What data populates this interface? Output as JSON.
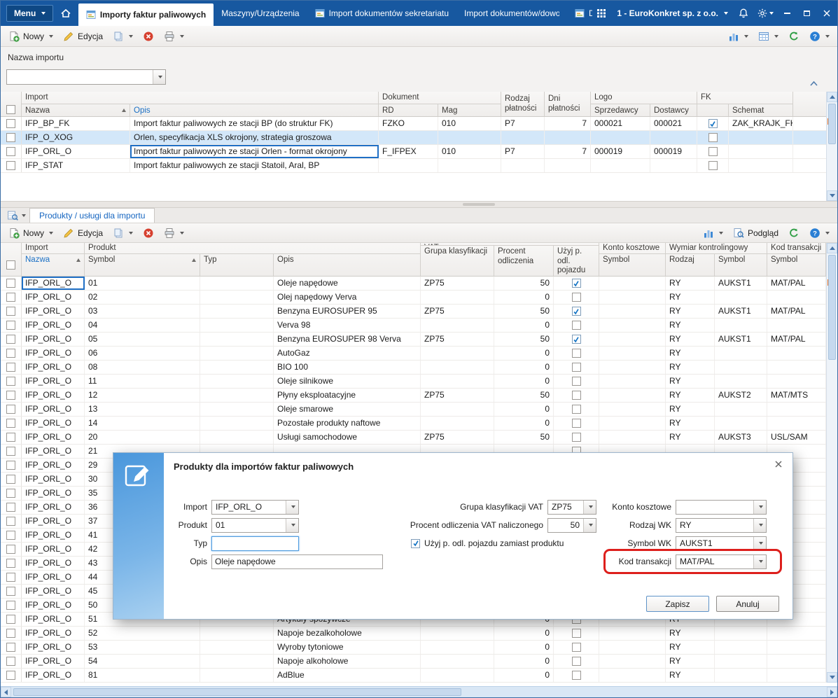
{
  "titlebar": {
    "menu_label": "Menu",
    "company_label": "1 - EuroKonkret sp. z o.o.",
    "tabs": [
      {
        "label": "Importy faktur paliwowych",
        "active": true,
        "icon": true
      },
      {
        "label": "Maszyny/Urządzenia",
        "active": false,
        "icon": false
      },
      {
        "label": "Import dokumentów sekretariatu",
        "active": false,
        "icon": true
      },
      {
        "label": "Import dokumentów/dowodów",
        "active": false,
        "icon": false,
        "truncate": true
      },
      {
        "label": "Dokumenty",
        "active": false,
        "icon": true
      }
    ]
  },
  "toolbars": {
    "new": "Nowy",
    "edit": "Edycja",
    "preview": "Podgląd"
  },
  "filter_panel": {
    "label": "Nazwa importu",
    "value": ""
  },
  "upper_grid": {
    "groups": {
      "import": "Import",
      "dokument": "Dokument",
      "logo": "Logo",
      "fk": "FK"
    },
    "columns": {
      "nazwa": "Nazwa",
      "opis": "Opis",
      "rd": "RD",
      "mag": "Mag",
      "rodzaj": "Rodzaj płatności",
      "dni": "Dni płatności",
      "sprzedawcy": "Sprzedawcy",
      "dostawcy": "Dostawcy",
      "schemat": "Schemat"
    },
    "sort_column": "nazwa",
    "focus_column": "opis",
    "rows": [
      {
        "nazwa": "IFP_BP_FK",
        "opis": "Import faktur paliwowych ze stacji BP (do struktur FK)",
        "rd": "FZKO",
        "mag": "010",
        "rodzaj": "P7",
        "dni": "7",
        "sprzedawcy": "000021",
        "dostawcy": "000021",
        "fk": true,
        "schemat": "ZAK_KRAJK_FK"
      },
      {
        "nazwa": "IFP_O_XOG",
        "opis": "Orlen, specyfikacja XLS okrojony, strategia groszowa",
        "rd": "",
        "mag": "",
        "rodzaj": "",
        "dni": "",
        "sprzedawcy": "",
        "dostawcy": "",
        "fk": false,
        "schemat": "",
        "selected": true
      },
      {
        "nazwa": "IFP_ORL_O",
        "opis": "Import faktur paliwowych ze stacji Orlen - format okrojony",
        "rd": "F_IFPEX",
        "mag": "010",
        "rodzaj": "P7",
        "dni": "7",
        "sprzedawcy": "000019",
        "dostawcy": "000019",
        "fk": false,
        "schemat": "",
        "focused_cell": "opis"
      },
      {
        "nazwa": "IFP_STAT",
        "opis": "Import faktur paliwowych ze stacji Statoil, Aral, BP",
        "rd": "",
        "mag": "",
        "rodzaj": "",
        "dni": "",
        "sprzedawcy": "",
        "dostawcy": "",
        "fk": false,
        "schemat": ""
      }
    ]
  },
  "lower_pane": {
    "tab_label": "Produkty / usługi dla importu"
  },
  "lower_grid": {
    "groups": {
      "import": "Import",
      "produkt": "Produkt",
      "vat": "VAT",
      "konto": "Konto kosztowe",
      "wymiar": "Wymiar kontrolingowy",
      "kod": "Kod transakcji"
    },
    "columns": {
      "nazwa": "Nazwa",
      "symbol": "Symbol",
      "typ": "Typ",
      "opis": "Opis",
      "grupa": "Grupa klasyfikacji",
      "procent": "Procent odliczenia",
      "uzyj": "Użyj p. odl. pojazdu",
      "konto_symbol": "Symbol",
      "rodzaj": "Rodzaj",
      "wymiar_symbol": "Symbol",
      "kod_symbol": "Symbol"
    },
    "sort_columns": [
      "nazwa",
      "symbol"
    ],
    "focus_column": "nazwa",
    "rows": [
      {
        "nazwa": "IFP_ORL_O",
        "symbol": "01",
        "typ": "",
        "opis": "Oleje napędowe",
        "grupa": "ZP75",
        "procent": "50",
        "uzyj": true,
        "konto": "",
        "rodzaj": "RY",
        "wymiar_symbol": "AUKST1",
        "kod": "MAT/PAL",
        "focused_cell": "nazwa"
      },
      {
        "nazwa": "IFP_ORL_O",
        "symbol": "02",
        "typ": "",
        "opis": "Olej napędowy Verva",
        "grupa": "",
        "procent": "0",
        "uzyj": false,
        "konto": "",
        "rodzaj": "RY",
        "wymiar_symbol": "",
        "kod": ""
      },
      {
        "nazwa": "IFP_ORL_O",
        "symbol": "03",
        "typ": "",
        "opis": "Benzyna EUROSUPER 95",
        "grupa": "ZP75",
        "procent": "50",
        "uzyj": true,
        "konto": "",
        "rodzaj": "RY",
        "wymiar_symbol": "AUKST1",
        "kod": "MAT/PAL"
      },
      {
        "nazwa": "IFP_ORL_O",
        "symbol": "04",
        "typ": "",
        "opis": "Verva 98",
        "grupa": "",
        "procent": "0",
        "uzyj": false,
        "konto": "",
        "rodzaj": "RY",
        "wymiar_symbol": "",
        "kod": ""
      },
      {
        "nazwa": "IFP_ORL_O",
        "symbol": "05",
        "typ": "",
        "opis": "Benzyna EUROSUPER 98 Verva",
        "grupa": "ZP75",
        "procent": "50",
        "uzyj": true,
        "konto": "",
        "rodzaj": "RY",
        "wymiar_symbol": "AUKST1",
        "kod": "MAT/PAL"
      },
      {
        "nazwa": "IFP_ORL_O",
        "symbol": "06",
        "typ": "",
        "opis": "AutoGaz",
        "grupa": "",
        "procent": "0",
        "uzyj": false,
        "konto": "",
        "rodzaj": "RY",
        "wymiar_symbol": "",
        "kod": ""
      },
      {
        "nazwa": "IFP_ORL_O",
        "symbol": "08",
        "typ": "",
        "opis": "BIO 100",
        "grupa": "",
        "procent": "0",
        "uzyj": false,
        "konto": "",
        "rodzaj": "RY",
        "wymiar_symbol": "",
        "kod": ""
      },
      {
        "nazwa": "IFP_ORL_O",
        "symbol": "11",
        "typ": "",
        "opis": "Oleje silnikowe",
        "grupa": "",
        "procent": "0",
        "uzyj": false,
        "konto": "",
        "rodzaj": "RY",
        "wymiar_symbol": "",
        "kod": ""
      },
      {
        "nazwa": "IFP_ORL_O",
        "symbol": "12",
        "typ": "",
        "opis": "Płyny eksploatacyjne",
        "grupa": "ZP75",
        "procent": "50",
        "uzyj": false,
        "konto": "",
        "rodzaj": "RY",
        "wymiar_symbol": "AUKST2",
        "kod": "MAT/MTS"
      },
      {
        "nazwa": "IFP_ORL_O",
        "symbol": "13",
        "typ": "",
        "opis": "Oleje smarowe",
        "grupa": "",
        "procent": "0",
        "uzyj": false,
        "konto": "",
        "rodzaj": "RY",
        "wymiar_symbol": "",
        "kod": ""
      },
      {
        "nazwa": "IFP_ORL_O",
        "symbol": "14",
        "typ": "",
        "opis": "Pozostałe produkty naftowe",
        "grupa": "",
        "procent": "0",
        "uzyj": false,
        "konto": "",
        "rodzaj": "RY",
        "wymiar_symbol": "",
        "kod": ""
      },
      {
        "nazwa": "IFP_ORL_O",
        "symbol": "20",
        "typ": "",
        "opis": "Usługi samochodowe",
        "grupa": "ZP75",
        "procent": "50",
        "uzyj": false,
        "konto": "",
        "rodzaj": "RY",
        "wymiar_symbol": "AUKST3",
        "kod": "USL/SAM"
      },
      {
        "nazwa": "IFP_ORL_O",
        "symbol": "21",
        "typ": "",
        "opis": "",
        "grupa": "",
        "procent": "",
        "uzyj": false,
        "konto": "",
        "rodzaj": "",
        "wymiar_symbol": "",
        "kod": ""
      },
      {
        "nazwa": "IFP_ORL_O",
        "symbol": "29",
        "typ": "",
        "opis": "",
        "grupa": "",
        "procent": "",
        "uzyj": false,
        "konto": "",
        "rodzaj": "",
        "wymiar_symbol": "",
        "kod": ""
      },
      {
        "nazwa": "IFP_ORL_O",
        "symbol": "30",
        "typ": "",
        "opis": "",
        "grupa": "",
        "procent": "",
        "uzyj": false,
        "konto": "",
        "rodzaj": "",
        "wymiar_symbol": "",
        "kod": ""
      },
      {
        "nazwa": "IFP_ORL_O",
        "symbol": "35",
        "typ": "",
        "opis": "",
        "grupa": "",
        "procent": "",
        "uzyj": false,
        "konto": "",
        "rodzaj": "",
        "wymiar_symbol": "",
        "kod": ""
      },
      {
        "nazwa": "IFP_ORL_O",
        "symbol": "36",
        "typ": "",
        "opis": "",
        "grupa": "",
        "procent": "",
        "uzyj": false,
        "konto": "",
        "rodzaj": "",
        "wymiar_symbol": "",
        "kod": ""
      },
      {
        "nazwa": "IFP_ORL_O",
        "symbol": "37",
        "typ": "",
        "opis": "",
        "grupa": "",
        "procent": "",
        "uzyj": false,
        "konto": "",
        "rodzaj": "",
        "wymiar_symbol": "",
        "kod": ""
      },
      {
        "nazwa": "IFP_ORL_O",
        "symbol": "41",
        "typ": "",
        "opis": "",
        "grupa": "",
        "procent": "",
        "uzyj": false,
        "konto": "",
        "rodzaj": "",
        "wymiar_symbol": "",
        "kod": ""
      },
      {
        "nazwa": "IFP_ORL_O",
        "symbol": "42",
        "typ": "",
        "opis": "",
        "grupa": "",
        "procent": "",
        "uzyj": false,
        "konto": "",
        "rodzaj": "",
        "wymiar_symbol": "",
        "kod": ""
      },
      {
        "nazwa": "IFP_ORL_O",
        "symbol": "43",
        "typ": "",
        "opis": "",
        "grupa": "",
        "procent": "",
        "uzyj": false,
        "konto": "",
        "rodzaj": "",
        "wymiar_symbol": "",
        "kod": ""
      },
      {
        "nazwa": "IFP_ORL_O",
        "symbol": "44",
        "typ": "",
        "opis": "",
        "grupa": "",
        "procent": "",
        "uzyj": false,
        "konto": "",
        "rodzaj": "",
        "wymiar_symbol": "",
        "kod": ""
      },
      {
        "nazwa": "IFP_ORL_O",
        "symbol": "45",
        "typ": "",
        "opis": "",
        "grupa": "",
        "procent": "",
        "uzyj": false,
        "konto": "",
        "rodzaj": "",
        "wymiar_symbol": "",
        "kod": ""
      },
      {
        "nazwa": "IFP_ORL_O",
        "symbol": "50",
        "typ": "",
        "opis": "",
        "grupa": "",
        "procent": "",
        "uzyj": false,
        "konto": "",
        "rodzaj": "",
        "wymiar_symbol": "",
        "kod": ""
      },
      {
        "nazwa": "IFP_ORL_O",
        "symbol": "51",
        "typ": "",
        "opis": "Artykuły spożywcze",
        "grupa": "",
        "procent": "0",
        "uzyj": false,
        "konto": "",
        "rodzaj": "RY",
        "wymiar_symbol": "",
        "kod": ""
      },
      {
        "nazwa": "IFP_ORL_O",
        "symbol": "52",
        "typ": "",
        "opis": "Napoje bezalkoholowe",
        "grupa": "",
        "procent": "0",
        "uzyj": false,
        "konto": "",
        "rodzaj": "RY",
        "wymiar_symbol": "",
        "kod": ""
      },
      {
        "nazwa": "IFP_ORL_O",
        "symbol": "53",
        "typ": "",
        "opis": "Wyroby tytoniowe",
        "grupa": "",
        "procent": "0",
        "uzyj": false,
        "konto": "",
        "rodzaj": "RY",
        "wymiar_symbol": "",
        "kod": ""
      },
      {
        "nazwa": "IFP_ORL_O",
        "symbol": "54",
        "typ": "",
        "opis": "Napoje alkoholowe",
        "grupa": "",
        "procent": "0",
        "uzyj": false,
        "konto": "",
        "rodzaj": "RY",
        "wymiar_symbol": "",
        "kod": ""
      },
      {
        "nazwa": "IFP_ORL_O",
        "symbol": "81",
        "typ": "",
        "opis": "AdBlue",
        "grupa": "",
        "procent": "0",
        "uzyj": false,
        "konto": "",
        "rodzaj": "RY",
        "wymiar_symbol": "",
        "kod": ""
      }
    ]
  },
  "dialog": {
    "title": "Produkty dla importów faktur paliwowych",
    "fields": {
      "import": {
        "label": "Import",
        "value": "IFP_ORL_O"
      },
      "produkt": {
        "label": "Produkt",
        "value": "01"
      },
      "typ": {
        "label": "Typ",
        "value": ""
      },
      "opis": {
        "label": "Opis",
        "value": "Oleje napędowe"
      },
      "grupa_vat": {
        "label": "Grupa klasyfikacji VAT",
        "value": "ZP75"
      },
      "procent_vat": {
        "label": "Procent odliczenia VAT naliczonego",
        "value": "50"
      },
      "uzyj": {
        "label": "Użyj p. odl. pojazdu zamiast produktu",
        "checked": true
      },
      "konto": {
        "label": "Konto kosztowe",
        "value": ""
      },
      "rodzaj_wk": {
        "label": "Rodzaj WK",
        "value": "RY"
      },
      "symbol_wk": {
        "label": "Symbol WK",
        "value": "AUKST1"
      },
      "kod": {
        "label": "Kod transakcji",
        "value": "MAT/PAL",
        "highlighted": true
      }
    },
    "save_label": "Zapisz",
    "cancel_label": "Anuluj"
  }
}
